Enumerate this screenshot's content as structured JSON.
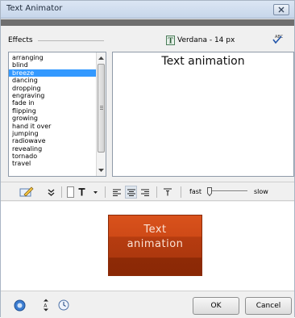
{
  "window": {
    "title": "Text Animator"
  },
  "effects": {
    "label": "Effects",
    "font_label": "Verdana - 14 px",
    "items": [
      {
        "label": "arranging",
        "selected": false
      },
      {
        "label": "blind",
        "selected": false
      },
      {
        "label": "breeze",
        "selected": true
      },
      {
        "label": "dancing",
        "selected": false
      },
      {
        "label": "dropping",
        "selected": false
      },
      {
        "label": "engraving",
        "selected": false
      },
      {
        "label": "fade in",
        "selected": false
      },
      {
        "label": "flipping",
        "selected": false
      },
      {
        "label": "growing",
        "selected": false
      },
      {
        "label": "hand it over",
        "selected": false
      },
      {
        "label": "jumping",
        "selected": false
      },
      {
        "label": "radiowave",
        "selected": false
      },
      {
        "label": "revealing",
        "selected": false
      },
      {
        "label": "tornado",
        "selected": false
      },
      {
        "label": "travel",
        "selected": false
      }
    ]
  },
  "text_input": {
    "value": "Text animation"
  },
  "toolbar": {
    "speed_fast_label": "fast",
    "speed_slow_label": "slow",
    "speed_value": 0.05
  },
  "preview": {
    "line1": "Text",
    "line2": "animation"
  },
  "buttons": {
    "ok_label": "OK",
    "cancel_label": "Cancel"
  },
  "colors": {
    "accent_selection": "#3399ff",
    "preview_box": "#c4461a",
    "dark_band": "#6f6f6f"
  }
}
